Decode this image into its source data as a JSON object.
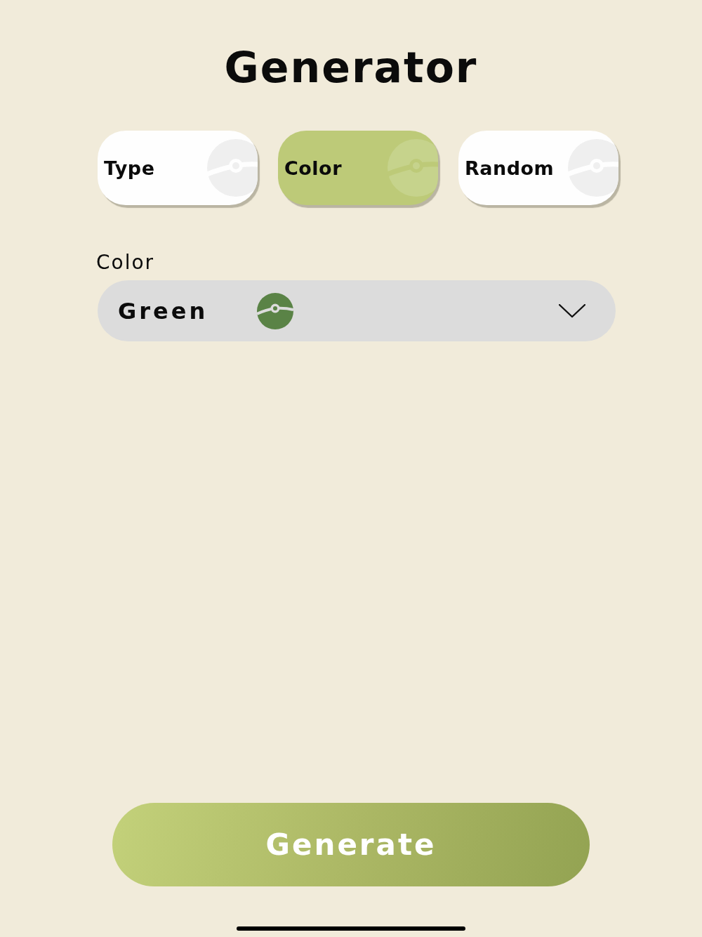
{
  "title": "Generator",
  "tabs": [
    {
      "label": "Type",
      "selected": false
    },
    {
      "label": "Color",
      "selected": true
    },
    {
      "label": "Random",
      "selected": false
    }
  ],
  "field": {
    "label": "Color",
    "value": "Green"
  },
  "action_button": {
    "label": "Generate"
  }
}
